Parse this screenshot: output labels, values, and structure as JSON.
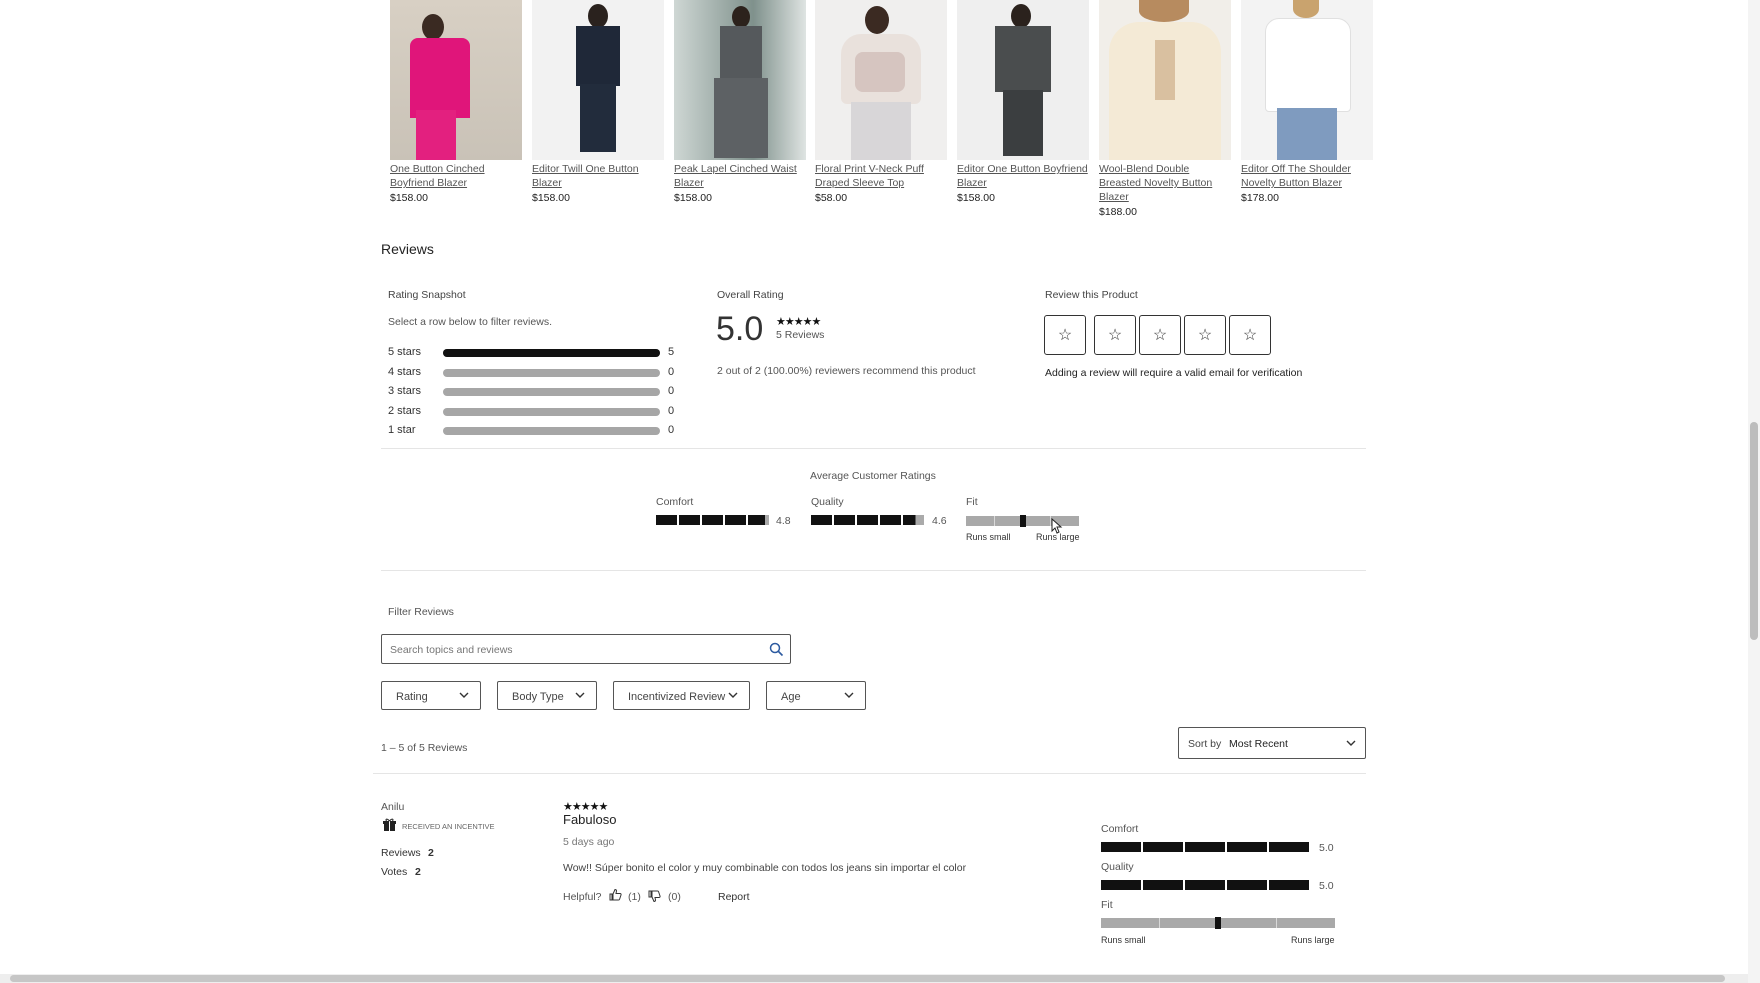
{
  "products": [
    {
      "name": "One Button Cinched Boyfriend Blazer",
      "price": "$158.00"
    },
    {
      "name": "Editor Twill One Button Blazer",
      "price": "$158.00"
    },
    {
      "name": "Peak Lapel Cinched Waist Blazer",
      "price": "$158.00"
    },
    {
      "name": "Floral Print V-Neck Puff Draped Sleeve Top",
      "price": "$58.00"
    },
    {
      "name": "Editor One Button Boyfriend Blazer",
      "price": "$158.00"
    },
    {
      "name": "Wool-Blend Double Breasted Novelty Button Blazer",
      "price": "$188.00"
    },
    {
      "name": "Editor Off The Shoulder Novelty Button Blazer",
      "price": "$178.00"
    }
  ],
  "reviews_title": "Reviews",
  "snapshot": {
    "title": "Rating Snapshot",
    "hint": "Select a row below to filter reviews.",
    "rows": [
      {
        "label": "5 stars",
        "count": "5",
        "fraction": 1.0
      },
      {
        "label": "4 stars",
        "count": "0",
        "fraction": 0
      },
      {
        "label": "3 stars",
        "count": "0",
        "fraction": 0
      },
      {
        "label": "2 stars",
        "count": "0",
        "fraction": 0
      },
      {
        "label": "1 star",
        "count": "0",
        "fraction": 0
      }
    ]
  },
  "overall": {
    "title": "Overall Rating",
    "score": "5.0",
    "stars": "★★★★★",
    "count": "5 Reviews",
    "recommend": "2 out of 2 (100.00%) reviewers recommend this product"
  },
  "review_product": {
    "title": "Review this Product",
    "star_glyph": "☆",
    "note": "Adding a review will require a valid email for verification"
  },
  "avg_ratings": {
    "title": "Average Customer Ratings",
    "comfort": {
      "label": "Comfort",
      "value": "4.8"
    },
    "quality": {
      "label": "Quality",
      "value": "4.6"
    },
    "fit": {
      "label": "Fit",
      "low": "Runs small",
      "high": "Runs large",
      "position": 0.5
    }
  },
  "filter": {
    "title": "Filter Reviews",
    "search_placeholder": "Search topics and reviews",
    "dropdowns": [
      "Rating",
      "Body Type",
      "Incentivized Review",
      "Age"
    ],
    "count_text": "1 – 5 of 5 Reviews",
    "sort_label": "Sort by",
    "sort_value": "Most Recent"
  },
  "review": {
    "author": "Anilu",
    "incentive": "RECEIVED AN INCENTIVE",
    "reviews_label": "Reviews",
    "reviews_count": "2",
    "votes_label": "Votes",
    "votes_count": "2",
    "stars": "★★★★★",
    "title": "Fabuloso",
    "date": "5 days ago",
    "body": "Wow!! Súper bonito el color y muy combinable con todos los jeans sin importar el color",
    "helpful_label": "Helpful?",
    "helpful_yes": "(1)",
    "helpful_no": "(0)",
    "report": "Report",
    "comfort": {
      "label": "Comfort",
      "value": "5.0"
    },
    "quality": {
      "label": "Quality",
      "value": "5.0"
    },
    "fit": {
      "label": "Fit",
      "low": "Runs small",
      "high": "Runs large",
      "position": 0.5
    }
  }
}
